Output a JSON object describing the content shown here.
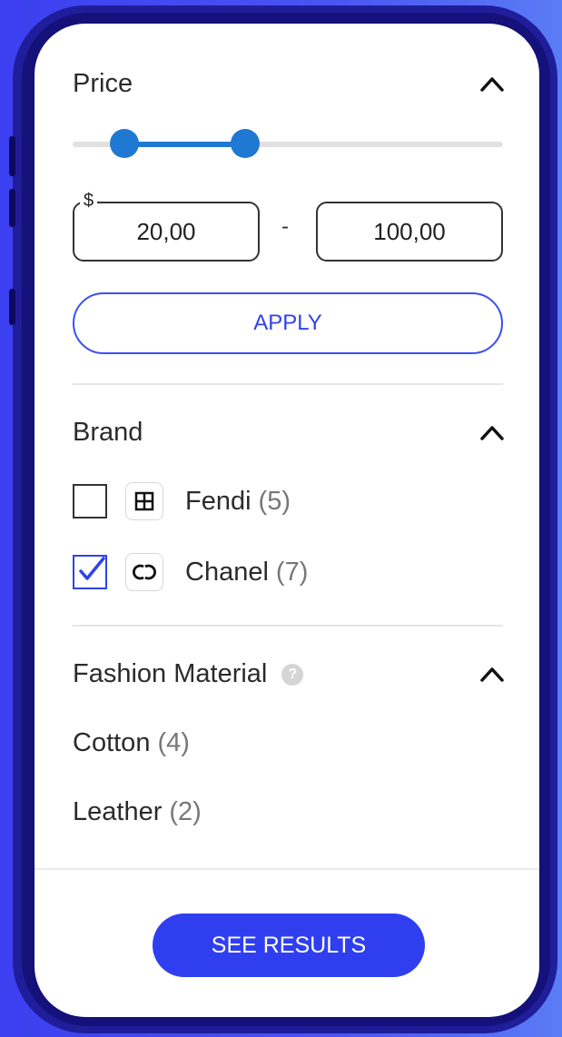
{
  "price": {
    "title": "Price",
    "range_min_fraction": 0.12,
    "range_max_fraction": 0.4,
    "currency": "$",
    "min_value": "20,00",
    "separator": "-",
    "max_value": "100,00",
    "apply_label": "APPLY"
  },
  "brand": {
    "title": "Brand",
    "items": [
      {
        "name": "Fendi",
        "count": "(5)",
        "checked": false,
        "logo_text": "FF"
      },
      {
        "name": "Chanel",
        "count": "(7)",
        "checked": true,
        "logo_text": "CC"
      }
    ]
  },
  "material": {
    "title": "Fashion Material",
    "help_icon": "?",
    "items": [
      {
        "name": "Cotton",
        "count": "(4)"
      },
      {
        "name": "Leather",
        "count": "(2)"
      }
    ]
  },
  "footer": {
    "see_results_label": "SEE RESULTS"
  },
  "colors": {
    "accent": "#2f3ff0",
    "slider": "#1f78d1",
    "phone_frame": "#1f1d9a"
  },
  "icons": {
    "collapse": "chevron-up-icon",
    "checkbox_checked": "checkmark-icon",
    "help": "question-circle-icon"
  }
}
